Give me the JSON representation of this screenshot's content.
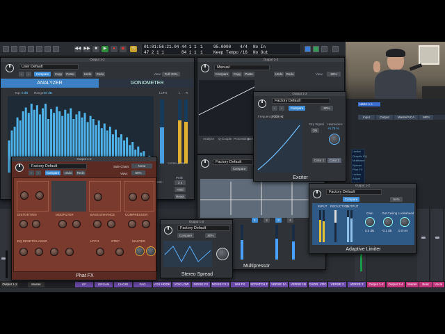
{
  "transport": {
    "position_bars": "01:01:56:21.04",
    "position_beats": "47 2 1 1",
    "bar1": "44 1 1",
    "bar2": "84 1 1",
    "tempo": "95.0000",
    "tempo_label": "Keep Tempo",
    "sig": "4/4",
    "div": "/16",
    "in_label": "No In",
    "out_label": "No Out",
    "bar1_sub": "1",
    "bar2_sub": "1"
  },
  "window_titles": {
    "left": "Output 1-2",
    "middle": "Output 1-2"
  },
  "analyzer": {
    "preset": "User Default",
    "compare": "Compare",
    "copy": "Copy",
    "paste": "Paste",
    "undo": "Undo",
    "redo": "Redo",
    "view_label": "View:",
    "view_value": "Full: 81%",
    "tab1": "ANALYZER",
    "tab2": "GONIOMETER",
    "top_label": "Top:",
    "top_value": "0 dB",
    "range_label": "Range:",
    "range_value": "60 dB",
    "lufs": "LUFS",
    "correlation": "CORRELATION",
    "l": "L",
    "r": "R",
    "peak_label": "Peak",
    "peak_value": "2 s",
    "hold": "Hold",
    "reset": "Reset",
    "ms_label": "MS :",
    "bars": [
      0.42,
      0.55,
      0.6,
      0.72,
      0.68,
      0.8,
      0.85,
      0.78,
      0.9,
      0.82,
      0.88,
      0.76,
      0.84,
      0.9,
      0.7,
      0.83,
      0.78,
      0.86,
      0.8,
      0.74,
      0.82,
      0.77,
      0.84,
      0.7,
      0.76,
      0.8,
      0.72,
      0.78,
      0.66,
      0.74,
      0.7,
      0.62,
      0.68,
      0.58,
      0.64,
      0.55,
      0.6,
      0.5,
      0.56,
      0.46,
      0.5,
      0.42,
      0.46,
      0.36,
      0.4,
      0.3,
      0.34,
      0.26,
      0.28,
      0.2,
      0.22,
      0.16
    ]
  },
  "eq": {
    "preset": "Manual",
    "compare": "Compare",
    "copy": "Copy",
    "paste": "Paste",
    "undo": "Undo",
    "redo": "Redo",
    "view_label": "View:",
    "view_value": "65%",
    "analyze": "Analyze",
    "q_couple": "Q-Couple",
    "processing": "Processing:",
    "stereo": "Stereo"
  },
  "exciter": {
    "title": "Output 1-2",
    "preset": "Factory Default",
    "compare": "Compare",
    "view": "80%",
    "freq_label": "Frequency",
    "freq_value": "7000 Hz",
    "dry_label": "Dry Signal",
    "dry_value": "ON",
    "harm_label": "Harmonics",
    "harm_value": "+5.75 %",
    "color1": "Color 1",
    "color2": "Color 2",
    "name": "Exciter"
  },
  "phatfx": {
    "title": "Output 1-2",
    "preset": "Factory Default",
    "compare": "Compare",
    "undo": "Undo",
    "redo": "Redo",
    "sidechain_label": "Side Chain:",
    "sidechain_value": "None",
    "view_label": "View:",
    "view_value": "60%",
    "sections": [
      "DISTORTION",
      "MODFILTER",
      "BASS ENHANCE",
      "COMPRESSOR",
      "EQ RESET/CLASSIC",
      "LFO 2",
      "STEP",
      "MASTER"
    ],
    "name": "Phat FX"
  },
  "multipressor": {
    "preset": "Factory Default",
    "compare": "Compare",
    "name": "Multipressor",
    "band_buttons": [
      "1",
      "2",
      "3",
      "4"
    ]
  },
  "spread": {
    "title": "Output 1-2",
    "preset": "Factory Default",
    "compare": "Compare",
    "view": "80%",
    "name": "Stereo Spread"
  },
  "limiter": {
    "title": "Output 1-2",
    "preset": "Factory Default",
    "compare": "Compare",
    "view": "54%",
    "input_label": "INPUT",
    "reduction_label": "REDUCTION",
    "output_label": "OUTPUT",
    "gain_label": "Gain",
    "gain_value": "0.0 dB",
    "ceiling_label": "Out Ceiling",
    "ceiling_value": "-0.1 dB",
    "lookahead_label": "Lookahead",
    "lookahead_value": "0.0 ms",
    "name": "Adaptive Limiter"
  },
  "right_list": {
    "header": [
      "Input",
      "Output",
      "Master/VCA",
      "MIDI"
    ],
    "items": [
      "Limiter",
      "Graphic EQ",
      "Multiband",
      "Spread",
      "Phat FX",
      "Limiter",
      "Adjust",
      "Multipressor"
    ]
  },
  "channel_names": [
    "Output 1-2",
    "Master",
    "EF",
    "ORGAN",
    "CHOIR",
    "PAD",
    "VOX HOOK",
    "VOX LOW",
    "NOISE FX",
    "NOISE FX 2",
    "WH FX",
    "SCRATCH FX",
    "VERSE 1A",
    "VERSE 1B",
    "CHOR. VOCAL",
    "VERSE 2",
    "VERSE 3",
    "Output 1-2",
    "Output 3-4",
    "Master",
    "Beat",
    "Vocal"
  ],
  "colors": {
    "accent": "#3f8fd8",
    "phat": "#8a3b2c",
    "pink_name": "#c0357a",
    "purple_name": "#6a4aa8"
  }
}
